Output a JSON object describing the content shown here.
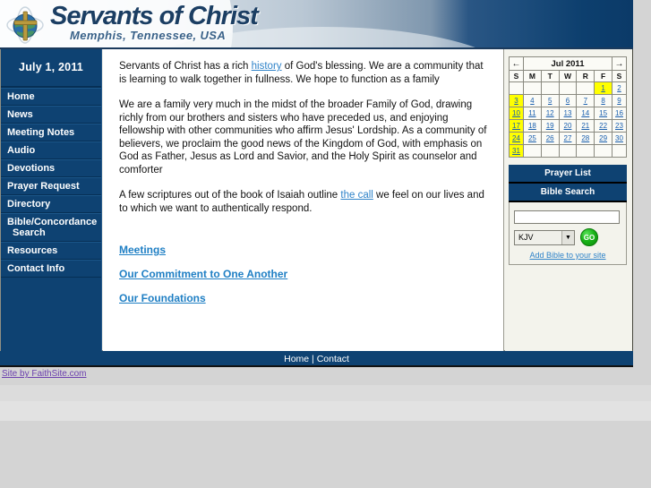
{
  "header": {
    "site_title": "Servants of Christ",
    "site_subtitle": "Memphis, Tennessee, USA",
    "logo_icon": "globe-cross-icon"
  },
  "colors": {
    "brand_blue": "#0e4272",
    "header_dark": "#0b3a68",
    "link_blue": "#2f83c9",
    "highlight_yellow": "#ffff00",
    "go_green": "#19b419",
    "rail_cream": "#f3f3ec",
    "page_gray": "#d4d4d4",
    "credit_purple": "#6b3fae"
  },
  "sidebar": {
    "date": "July 1, 2011",
    "items": [
      {
        "label": "Home"
      },
      {
        "label": "News"
      },
      {
        "label": "Meeting Notes"
      },
      {
        "label": "Audio"
      },
      {
        "label": "Devotions"
      },
      {
        "label": "Prayer Request"
      },
      {
        "label": "Directory"
      },
      {
        "label": "Bible/Concordance",
        "label2": "Search"
      },
      {
        "label": "Resources"
      },
      {
        "label": "Contact Info"
      }
    ]
  },
  "main": {
    "paragraph1_a": "Servants of Christ has a rich ",
    "paragraph1_link": "history",
    "paragraph1_b": " of God's blessing. We are a community that is learning to walk together in fullness. We hope to function as a family",
    "paragraph2": "We are a family very much in the midst of the broader Family of God, drawing richly from our brothers and sisters who have preceded us, and enjoying fellowship with other communities who affirm Jesus' Lordship. As a community of believers, we proclaim the good news of the Kingdom of God, with emphasis on God as Father, Jesus as Lord and Savior, and the Holy Spirit as counselor and comforter",
    "paragraph3_a": "A few scriptures out of the book of Isaiah outline ",
    "paragraph3_link": "the call",
    "paragraph3_b": " we feel on our lives and to which we want to authentically respond.",
    "links": [
      {
        "label": "Meetings"
      },
      {
        "label": "Our Commitment to One Another"
      },
      {
        "label": "Our Foundations"
      }
    ]
  },
  "calendar": {
    "prev_icon": "arrow-left-icon",
    "next_icon": "arrow-right-icon",
    "month_label": "Jul 2011",
    "dow": [
      "S",
      "M",
      "T",
      "W",
      "R",
      "F",
      "S"
    ],
    "weeks": [
      [
        null,
        null,
        null,
        null,
        null,
        {
          "d": "1",
          "hl": true
        },
        {
          "d": "2",
          "hl": false
        }
      ],
      [
        {
          "d": "3",
          "hl": true
        },
        {
          "d": "4",
          "hl": false
        },
        {
          "d": "5",
          "hl": false
        },
        {
          "d": "6",
          "hl": false
        },
        {
          "d": "7",
          "hl": false
        },
        {
          "d": "8",
          "hl": false
        },
        {
          "d": "9",
          "hl": false
        }
      ],
      [
        {
          "d": "10",
          "hl": true
        },
        {
          "d": "11",
          "hl": false
        },
        {
          "d": "12",
          "hl": false
        },
        {
          "d": "13",
          "hl": false
        },
        {
          "d": "14",
          "hl": false
        },
        {
          "d": "15",
          "hl": false
        },
        {
          "d": "16",
          "hl": false
        }
      ],
      [
        {
          "d": "17",
          "hl": true
        },
        {
          "d": "18",
          "hl": false
        },
        {
          "d": "19",
          "hl": false
        },
        {
          "d": "20",
          "hl": false
        },
        {
          "d": "21",
          "hl": false
        },
        {
          "d": "22",
          "hl": false
        },
        {
          "d": "23",
          "hl": false
        }
      ],
      [
        {
          "d": "24",
          "hl": true
        },
        {
          "d": "25",
          "hl": false
        },
        {
          "d": "26",
          "hl": false
        },
        {
          "d": "27",
          "hl": false
        },
        {
          "d": "28",
          "hl": false
        },
        {
          "d": "29",
          "hl": false
        },
        {
          "d": "30",
          "hl": false
        }
      ],
      [
        {
          "d": "31",
          "hl": true
        },
        null,
        null,
        null,
        null,
        null,
        null
      ]
    ]
  },
  "rail": {
    "prayer_list_title": "Prayer List",
    "bible_search_title": "Bible Search",
    "search_value": "",
    "search_placeholder": "",
    "version_selected": "KJV",
    "version_options": [
      "KJV"
    ],
    "go_label": "GO",
    "add_bible_label": "Add Bible to your site"
  },
  "footer": {
    "home_label": "Home",
    "separator": "|",
    "contact_label": "Contact",
    "credit_label": "Site by FaithSite.com"
  }
}
